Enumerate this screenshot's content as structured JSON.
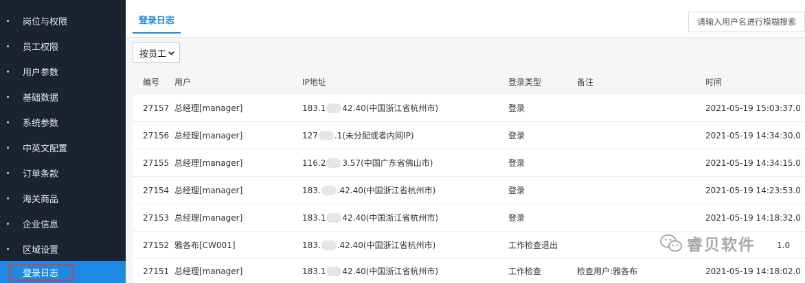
{
  "sidebar": {
    "items": [
      {
        "label": "岗位与权限",
        "active": false
      },
      {
        "label": "员工权限",
        "active": false
      },
      {
        "label": "用户参数",
        "active": false
      },
      {
        "label": "基础数据",
        "active": false
      },
      {
        "label": "系统参数",
        "active": false
      },
      {
        "label": "中英文配置",
        "active": false
      },
      {
        "label": "订单条款",
        "active": false
      },
      {
        "label": "海关商品",
        "active": false
      },
      {
        "label": "企业信息",
        "active": false
      },
      {
        "label": "区域设置",
        "active": false
      },
      {
        "label": "登录日志",
        "active": true
      }
    ]
  },
  "header": {
    "tab_label": "登录日志",
    "search_placeholder": "请输入用户名进行模糊搜索"
  },
  "filter": {
    "selected": "按员工"
  },
  "table": {
    "columns": {
      "id": "编号",
      "user": "用户",
      "ip": "IP地址",
      "type": "登录类型",
      "remark": "备注",
      "time": "时间"
    },
    "rows": [
      {
        "id": "27157",
        "user": "总经理[manager]",
        "ip_a": "183.1",
        "ip_b": "42.40(中国浙江省杭州市)",
        "type": "登录",
        "remark": "",
        "time": "2021-05-19 15:03:37.0"
      },
      {
        "id": "27156",
        "user": "总经理[manager]",
        "ip_a": "127",
        "ip_b": ".1(未分配或者内网IP)",
        "type": "登录",
        "remark": "",
        "time": "2021-05-19 14:34:30.0"
      },
      {
        "id": "27155",
        "user": "总经理[manager]",
        "ip_a": "116.2",
        "ip_b": "3.57(中国广东省佛山市)",
        "type": "登录",
        "remark": "",
        "time": "2021-05-19 14:34:15.0"
      },
      {
        "id": "27154",
        "user": "总经理[manager]",
        "ip_a": "183.",
        "ip_b": ".42.40(中国浙江省杭州市)",
        "type": "登录",
        "remark": "",
        "time": "2021-05-19 14:23:53.0"
      },
      {
        "id": "27153",
        "user": "总经理[manager]",
        "ip_a": "183.1",
        "ip_b": "42.40(中国浙江省杭州市)",
        "type": "登录",
        "remark": "",
        "time": "2021-05-19 14:18:32.0"
      },
      {
        "id": "27152",
        "user": "雅各布[CW001]",
        "ip_a": "183.",
        "ip_b": ".42.40(中国浙江省杭州市)",
        "type": "工作检查退出",
        "remark": "",
        "time": "1.0"
      },
      {
        "id": "27151",
        "user": "总经理[manager]",
        "ip_a": "183.1",
        "ip_b": "42.40(中国浙江省杭州市)",
        "type": "工作检查",
        "remark": "检查用户:雅各布",
        "time": "2021-05-19 14:18:02.0"
      }
    ]
  },
  "watermark": {
    "text": "睿贝软件",
    "icon": "wechat-icon"
  },
  "colors": {
    "sidebar_bg": "#1b2331",
    "accent": "#1e88e5",
    "highlight_border": "#e53935"
  }
}
